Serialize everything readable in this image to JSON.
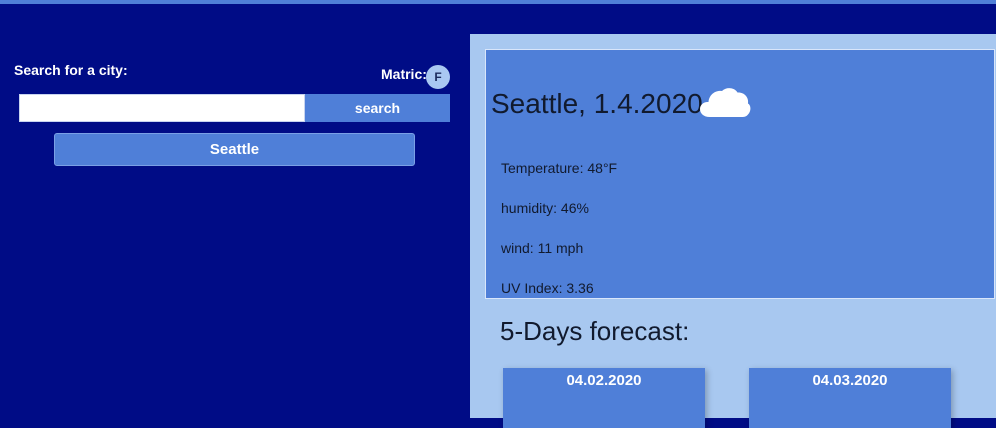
{
  "search": {
    "label": "Search for a city:",
    "input_value": "",
    "placeholder": "",
    "button_label": "search"
  },
  "metric": {
    "label": "Matric:",
    "unit": "F"
  },
  "history": {
    "cities": [
      "Seattle"
    ]
  },
  "current": {
    "title": "Seattle, 1.4.2020",
    "icon": "cloud-icon",
    "temperature": "Temperature: 48°F",
    "humidity": "humidity: 46%",
    "wind": "wind: 11 mph",
    "uv_index": "UV Index: 3.36"
  },
  "forecast": {
    "heading": "5-Days forecast:",
    "days": [
      {
        "date": "04.02.2020"
      },
      {
        "date": "04.03.2020"
      }
    ]
  },
  "colors": {
    "page_background": "#000c86",
    "accent": "#4f7fd8",
    "panel_background": "#a8c8f0"
  }
}
